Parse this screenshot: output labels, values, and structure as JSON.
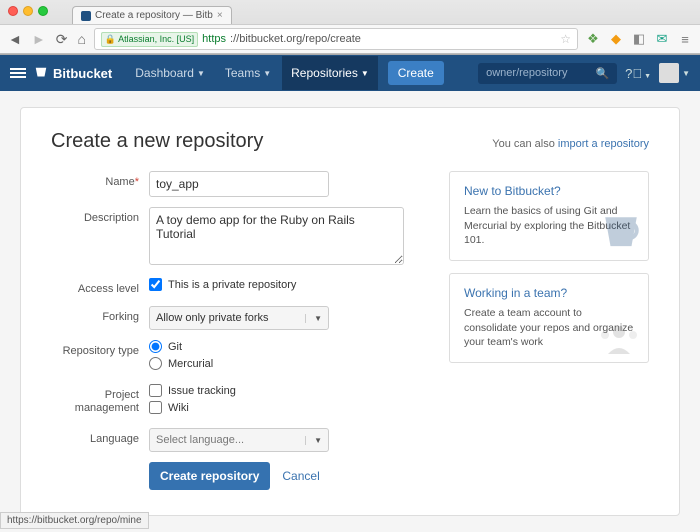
{
  "browser": {
    "tab_title": "Create a repository — Bitb",
    "lock_text": "Atlassian, Inc. [US]",
    "url_secure": "https",
    "url_rest": "://bitbucket.org/repo/create",
    "status_bar": "https://bitbucket.org/repo/mine"
  },
  "nav": {
    "brand": "Bitbucket",
    "items": {
      "dashboard": "Dashboard",
      "teams": "Teams",
      "repositories": "Repositories"
    },
    "create": "Create",
    "search_placeholder": "owner/repository"
  },
  "page": {
    "title": "Create a new repository",
    "import_prefix": "You can also ",
    "import_link": "import a repository"
  },
  "form": {
    "labels": {
      "name": "Name",
      "description": "Description",
      "access": "Access level",
      "forking": "Forking",
      "repo_type": "Repository type",
      "project_mgmt": "Project management",
      "language": "Language"
    },
    "name_value": "toy_app",
    "description_value": "A toy demo app for the Ruby on Rails Tutorial",
    "access_checkbox": "This is a private repository",
    "access_checked": true,
    "forking_selected": "Allow only private forks",
    "repo_type": {
      "git": "Git",
      "mercurial": "Mercurial",
      "selected": "git"
    },
    "pm": {
      "issue": "Issue tracking",
      "wiki": "Wiki"
    },
    "language_placeholder": "Select language...",
    "submit": "Create repository",
    "cancel": "Cancel"
  },
  "sidebar": {
    "new_title": "New to Bitbucket?",
    "new_body": "Learn the basics of using Git and Mercurial by exploring the Bitbucket 101.",
    "team_title": "Working in a team?",
    "team_body": "Create a team account to consolidate your repos and organize your team's work"
  }
}
